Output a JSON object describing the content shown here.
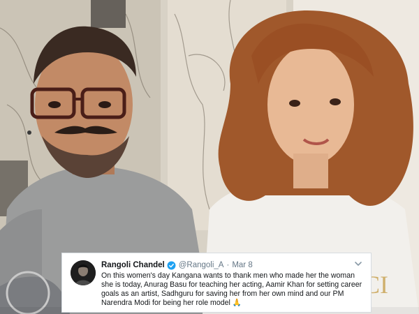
{
  "tweet": {
    "name": "Rangoli Chandel",
    "handle": "@Rangoli_A",
    "separator": "·",
    "date": "Mar 8",
    "text": "On this women's day Kangana wants to thank men who made her the woman she is today, Anurag Basu for teaching her acting, Aamir Khan for setting career goals as an artist, Sadhguru for saving her from her own mind and our PM Narendra Modi for being her role model",
    "emoji": "🙏",
    "verified_color": "#1da1f2"
  },
  "photo": {
    "watermark_text": "GUCCI"
  }
}
